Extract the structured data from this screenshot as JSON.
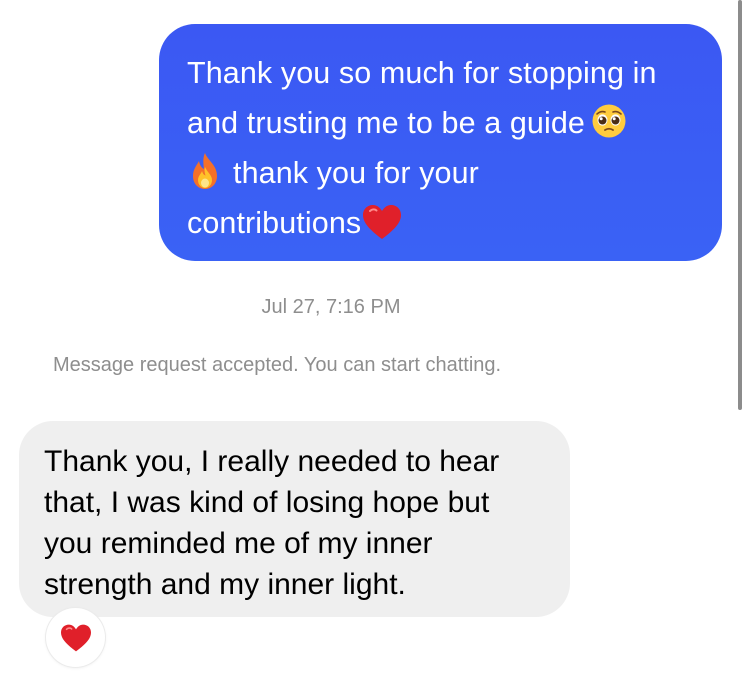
{
  "thread": {
    "outgoing": {
      "lines": [
        "Thank you so much for stopping in",
        "and trusting me to be a guide",
        "thank you for your",
        "contributions"
      ],
      "emoji": [
        "pleading-face-emoji",
        "fire-emoji",
        "red-heart-emoji"
      ],
      "color": "#3a5df4"
    },
    "timestamp": "Jul 27, 7:16 PM",
    "system_message": "Message request accepted. You can start chatting.",
    "incoming": {
      "lines": [
        "Thank you, I really needed to hear",
        "that, I was kind of losing hope but",
        "you reminded me of my inner",
        "strength and my inner light."
      ],
      "color": "#efefef",
      "reaction": "red-heart-emoji"
    }
  }
}
